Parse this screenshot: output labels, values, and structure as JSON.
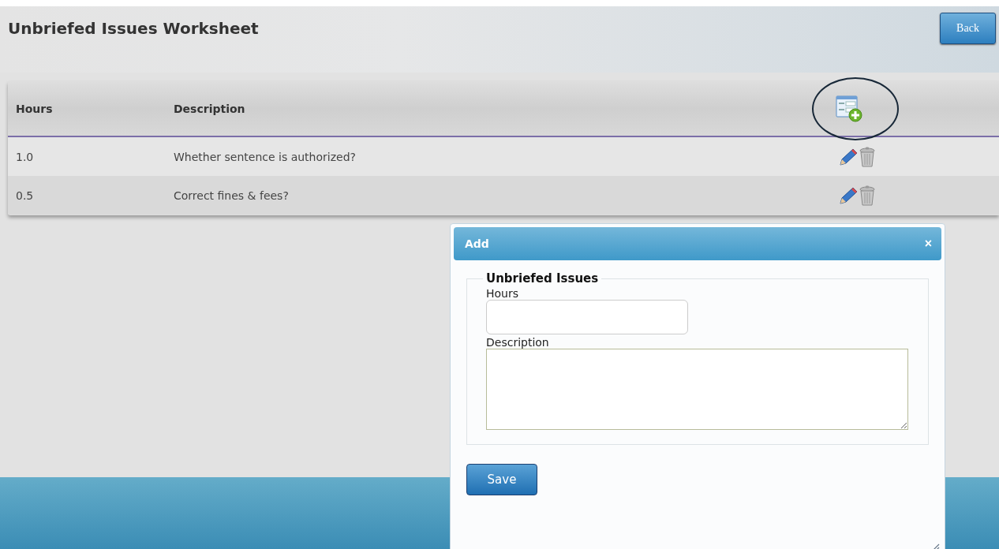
{
  "header": {
    "title": "Unbriefed Issues Worksheet",
    "back_button": "Back"
  },
  "table": {
    "columns": [
      "Hours",
      "Description"
    ],
    "rows": [
      {
        "hours": "1.0",
        "description": "Whether sentence is authorized?"
      },
      {
        "hours": "0.5",
        "description": "Correct fines & fees?"
      }
    ]
  },
  "dialog": {
    "title": "Add",
    "close": "×",
    "legend": "Unbriefed Issues",
    "fields": [
      {
        "kind": "input",
        "label": "Hours"
      },
      {
        "kind": "textarea",
        "label": "Description"
      }
    ],
    "save_button": "Save"
  }
}
